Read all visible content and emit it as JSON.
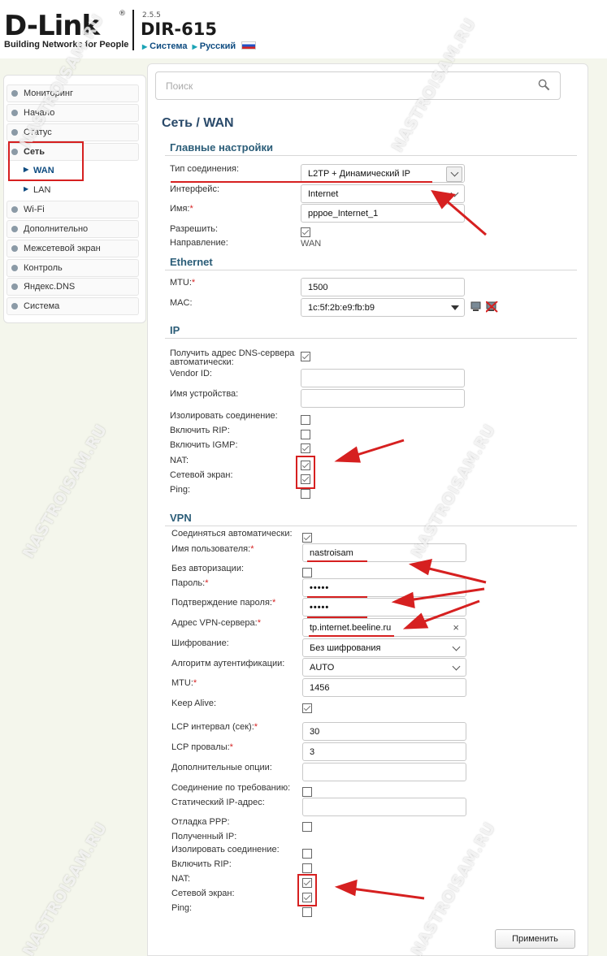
{
  "header": {
    "brand": "D-Link",
    "reg": "®",
    "tagline": "Building Networks for People",
    "firmware": "2.5.5",
    "model": "DIR-615",
    "system_link": "Система",
    "language_link": "Русский"
  },
  "sidebar": {
    "items": [
      {
        "label": "Мониторинг"
      },
      {
        "label": "Начало"
      },
      {
        "label": "Статус"
      },
      {
        "label": "Сеть"
      },
      {
        "label": "WAN"
      },
      {
        "label": "LAN"
      },
      {
        "label": "Wi-Fi"
      },
      {
        "label": "Дополнительно"
      },
      {
        "label": "Межсетевой экран"
      },
      {
        "label": "Контроль"
      },
      {
        "label": "Яндекс.DNS"
      },
      {
        "label": "Система"
      }
    ]
  },
  "search": {
    "placeholder": "Поиск"
  },
  "page": {
    "title": "Сеть /  WAN"
  },
  "main_settings": {
    "title": "Главные настройки",
    "connection_type_label": "Тип соединения:",
    "connection_type_value": "L2TP + Динамический IP",
    "interface_label": "Интерфейс:",
    "interface_value": "Internet",
    "name_label": "Имя:",
    "name_value": "pppoe_Internet_1",
    "allow_label": "Разрешить:",
    "direction_label": "Направление:",
    "direction_value": "WAN"
  },
  "ethernet": {
    "title": "Ethernet",
    "mtu_label": "MTU:",
    "mtu_value": "1500",
    "mac_label": "MAC:",
    "mac_value": "1c:5f:2b:e9:fb:b9"
  },
  "ip": {
    "title": "IP",
    "dns_auto_label_1": "Получить адрес DNS-сервера",
    "dns_auto_label_2": "автоматически:",
    "vendor_id_label": "Vendor ID:",
    "device_name_label": "Имя устройства:",
    "isolate_label": "Изолировать соединение:",
    "rip_label": "Включить RIP:",
    "igmp_label": "Включить IGMP:",
    "nat_label": "NAT:",
    "firewall_label": "Сетевой экран:",
    "ping_label": "Ping:"
  },
  "vpn": {
    "title": "VPN",
    "auto_connect_label": "Соединяться автоматически:",
    "username_label": "Имя пользователя:",
    "username_value": "nastroisam",
    "no_auth_label": "Без авторизации:",
    "password_label": "Пароль:",
    "password_value": "•••••",
    "password_confirm_label": "Подтверждение пароля:",
    "password_confirm_value": "•••••",
    "server_label": "Адрес VPN-сервера:",
    "server_value": "tp.internet.beeline.ru",
    "encryption_label": "Шифрование:",
    "encryption_value": "Без шифрования",
    "auth_algo_label": "Алгоритм аутентификации:",
    "auth_algo_value": "AUTO",
    "mtu_label": "MTU:",
    "mtu_value": "1456",
    "keepalive_label": "Keep Alive:",
    "lcp_interval_label": "LCP интервал (сек):",
    "lcp_interval_value": "30",
    "lcp_fails_label": "LCP провалы:",
    "lcp_fails_value": "3",
    "extra_options_label": "Дополнительные опции:",
    "on_demand_label": "Соединение по требованию:",
    "static_ip_label": "Статический IP-адрес:",
    "ppp_debug_label": "Отладка PPP:",
    "received_ip_label": "Полученный IP:",
    "isolate_label": "Изолировать соединение:",
    "rip_label": "Включить RIP:",
    "nat_label": "NAT:",
    "firewall_label": "Сетевой экран:",
    "ping_label": "Ping:"
  },
  "required_mark": "*",
  "apply_label": "Применить",
  "watermark": "NASTROISAM.RU",
  "colors": {
    "annotation": "#d62020",
    "section": "#2b5d78",
    "link": "#0f4c81"
  }
}
